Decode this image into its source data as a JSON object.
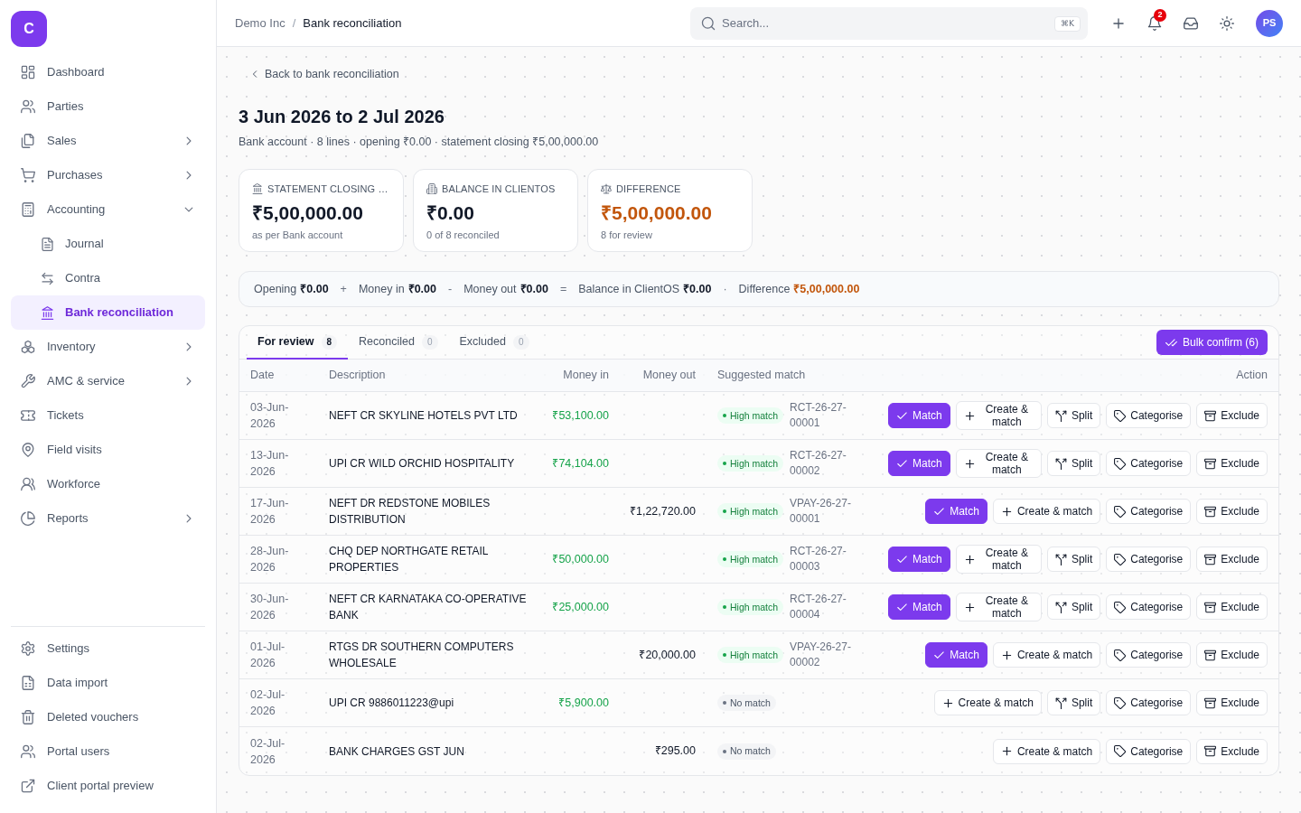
{
  "sidebar": {
    "logo": "C",
    "items": [
      {
        "label": "Dashboard",
        "kind": "link",
        "selected": false
      },
      {
        "label": "Parties",
        "kind": "link",
        "selected": false
      },
      {
        "label": "Sales",
        "kind": "group",
        "expanded": false,
        "selected": false
      },
      {
        "label": "Purchases",
        "kind": "group",
        "expanded": false,
        "selected": false
      },
      {
        "label": "Accounting",
        "kind": "group",
        "expanded": true,
        "selected": false,
        "children": [
          {
            "label": "Journal",
            "selected": false
          },
          {
            "label": "Contra",
            "selected": false
          },
          {
            "label": "Bank reconciliation",
            "selected": true
          }
        ]
      },
      {
        "label": "Inventory",
        "kind": "group",
        "expanded": false,
        "selected": false
      },
      {
        "label": "AMC & service",
        "kind": "group",
        "expanded": false,
        "selected": false
      },
      {
        "label": "Tickets",
        "kind": "link",
        "selected": false
      },
      {
        "label": "Field visits",
        "kind": "link",
        "selected": false
      },
      {
        "label": "Workforce",
        "kind": "link",
        "selected": false
      },
      {
        "label": "Reports",
        "kind": "group",
        "expanded": false,
        "selected": false
      }
    ],
    "footer_items": [
      {
        "label": "Settings",
        "selected": false
      },
      {
        "label": "Data import",
        "selected": false
      },
      {
        "label": "Deleted vouchers",
        "selected": false
      },
      {
        "label": "Portal users",
        "selected": false
      },
      {
        "label": "Client portal preview",
        "selected": false
      }
    ]
  },
  "header": {
    "breadcrumb": {
      "separator": "/",
      "items": [
        {
          "label": "Demo Inc",
          "current": false
        },
        {
          "label": "Bank reconciliation",
          "current": true
        }
      ]
    },
    "search": {
      "placeholder": "Search...",
      "shortcut": "⌘K"
    },
    "notification_count": "2",
    "avatar": "PS"
  },
  "page": {
    "back_link": "Back to bank reconciliation",
    "title": "3 Jun 2026 to 2 Jul 2026",
    "subtitle": "Bank account · 8 lines · opening ₹0.00 · statement closing ₹5,00,000.00",
    "stat_cards": [
      {
        "label": "STATEMENT CLOSING …",
        "value": "₹5,00,000.00",
        "note": "as per Bank account",
        "color": "#111827"
      },
      {
        "label": "BALANCE IN CLIENTOS",
        "value": "₹0.00",
        "note": "0 of 8 reconciled",
        "color": "#111827"
      },
      {
        "label": "DIFFERENCE",
        "value": "₹5,00,000.00",
        "note": "8 for review",
        "color": "#c2560c"
      }
    ],
    "equation": [
      {
        "kind": "term",
        "label": "Opening",
        "value": "₹0.00",
        "color": "#111827"
      },
      {
        "kind": "operator",
        "symbol": "+"
      },
      {
        "kind": "term",
        "label": "Money in",
        "value": "₹0.00",
        "color": "#111827"
      },
      {
        "kind": "operator",
        "symbol": "-"
      },
      {
        "kind": "term",
        "label": "Money out",
        "value": "₹0.00",
        "color": "#111827"
      },
      {
        "kind": "operator",
        "symbol": "="
      },
      {
        "kind": "term",
        "label": "Balance in ClientOS",
        "value": "₹0.00",
        "color": "#111827"
      },
      {
        "kind": "operator",
        "symbol": "·"
      },
      {
        "kind": "term",
        "label": "Difference",
        "value": "₹5,00,000.00",
        "color": "#c2560c"
      }
    ],
    "tabs": [
      {
        "label": "For review",
        "count": "8",
        "selected": true
      },
      {
        "label": "Reconciled",
        "count": "0",
        "selected": false
      },
      {
        "label": "Excluded",
        "count": "0",
        "selected": false
      }
    ],
    "bulk_action": "Bulk confirm (6)",
    "table": {
      "columns": [
        "Date",
        "Description",
        "Money in",
        "Money out",
        "Suggested match",
        "Action"
      ],
      "rows": [
        {
          "date": "03-Jun-2026",
          "description": "NEFT CR SKYLINE HOTELS PVT LTD",
          "money_in": "₹53,100.00",
          "match": {
            "kind": "high",
            "label": "High match",
            "reference": "RCT-26-27-00001"
          },
          "actions": [
            {
              "kind": "match",
              "label": "Match"
            },
            {
              "kind": "create",
              "label": "Create & match"
            },
            {
              "kind": "split",
              "label": "Split"
            },
            {
              "kind": "categorise",
              "label": "Categorise"
            },
            {
              "kind": "exclude",
              "label": "Exclude"
            }
          ]
        },
        {
          "date": "13-Jun-2026",
          "description": "UPI CR WILD ORCHID HOSPITALITY",
          "money_in": "₹74,104.00",
          "match": {
            "kind": "high",
            "label": "High match",
            "reference": "RCT-26-27-00002"
          },
          "actions": [
            {
              "kind": "match",
              "label": "Match"
            },
            {
              "kind": "create",
              "label": "Create & match"
            },
            {
              "kind": "split",
              "label": "Split"
            },
            {
              "kind": "categorise",
              "label": "Categorise"
            },
            {
              "kind": "exclude",
              "label": "Exclude"
            }
          ]
        },
        {
          "date": "17-Jun-2026",
          "description": "NEFT DR REDSTONE MOBILES DISTRIBUTION",
          "money_out": "₹1,22,720.00",
          "match": {
            "kind": "high",
            "label": "High match",
            "reference": "VPAY-26-27-00001"
          },
          "actions": [
            {
              "kind": "match",
              "label": "Match"
            },
            {
              "kind": "create",
              "label": "Create & match"
            },
            {
              "kind": "categorise",
              "label": "Categorise"
            },
            {
              "kind": "exclude",
              "label": "Exclude"
            }
          ]
        },
        {
          "date": "28-Jun-2026",
          "description": "CHQ DEP NORTHGATE RETAIL PROPERTIES",
          "money_in": "₹50,000.00",
          "match": {
            "kind": "high",
            "label": "High match",
            "reference": "RCT-26-27-00003"
          },
          "actions": [
            {
              "kind": "match",
              "label": "Match"
            },
            {
              "kind": "create",
              "label": "Create & match"
            },
            {
              "kind": "split",
              "label": "Split"
            },
            {
              "kind": "categorise",
              "label": "Categorise"
            },
            {
              "kind": "exclude",
              "label": "Exclude"
            }
          ]
        },
        {
          "date": "30-Jun-2026",
          "description": "NEFT CR KARNATAKA CO-OPERATIVE BANK",
          "money_in": "₹25,000.00",
          "match": {
            "kind": "high",
            "label": "High match",
            "reference": "RCT-26-27-00004"
          },
          "actions": [
            {
              "kind": "match",
              "label": "Match"
            },
            {
              "kind": "create",
              "label": "Create & match"
            },
            {
              "kind": "split",
              "label": "Split"
            },
            {
              "kind": "categorise",
              "label": "Categorise"
            },
            {
              "kind": "exclude",
              "label": "Exclude"
            }
          ]
        },
        {
          "date": "01-Jul-2026",
          "description": "RTGS DR SOUTHERN COMPUTERS WHOLESALE",
          "money_out": "₹20,000.00",
          "match": {
            "kind": "high",
            "label": "High match",
            "reference": "VPAY-26-27-00002"
          },
          "actions": [
            {
              "kind": "match",
              "label": "Match"
            },
            {
              "kind": "create",
              "label": "Create & match"
            },
            {
              "kind": "categorise",
              "label": "Categorise"
            },
            {
              "kind": "exclude",
              "label": "Exclude"
            }
          ]
        },
        {
          "date": "02-Jul-2026",
          "description": "UPI CR 9886011223@upi",
          "money_in": "₹5,900.00",
          "match": {
            "kind": "none",
            "label": "No match"
          },
          "actions": [
            {
              "kind": "create",
              "label": "Create & match"
            },
            {
              "kind": "split",
              "label": "Split"
            },
            {
              "kind": "categorise",
              "label": "Categorise"
            },
            {
              "kind": "exclude",
              "label": "Exclude"
            }
          ]
        },
        {
          "date": "02-Jul-2026",
          "description": "BANK CHARGES GST JUN",
          "money_out": "₹295.00",
          "match": {
            "kind": "none",
            "label": "No match"
          },
          "actions": [
            {
              "kind": "create",
              "label": "Create & match"
            },
            {
              "kind": "categorise",
              "label": "Categorise"
            },
            {
              "kind": "exclude",
              "label": "Exclude"
            }
          ]
        }
      ]
    }
  }
}
